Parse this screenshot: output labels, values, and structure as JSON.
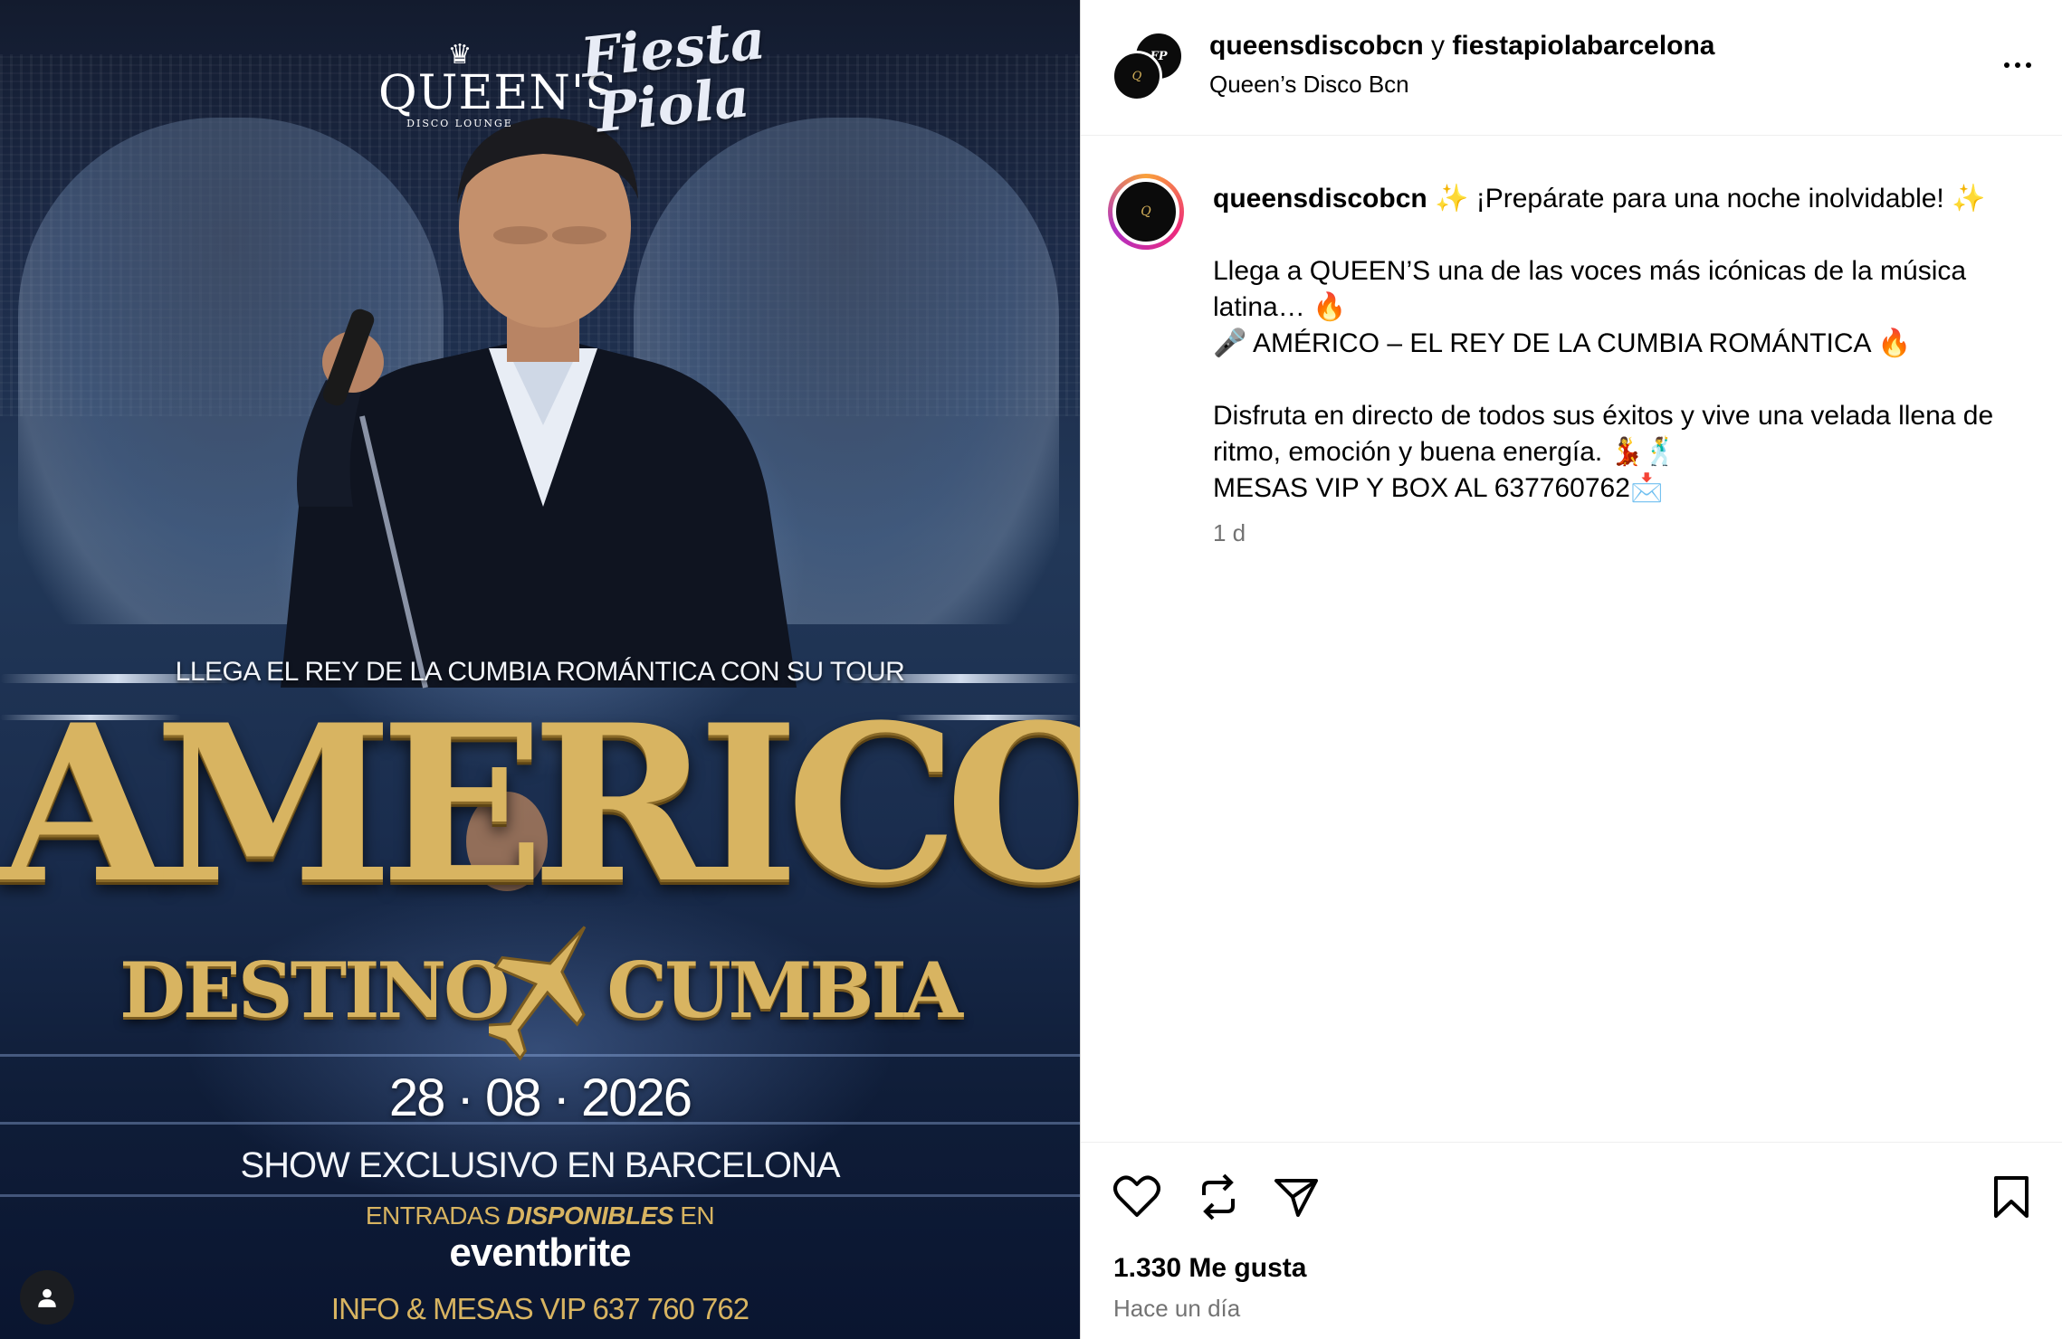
{
  "poster": {
    "logo_queens_big": "QUEEN'S",
    "logo_queens_small": "DISCO LOUNGE",
    "logo_fiesta": "Fiesta Piola",
    "tour_line": "LLEGA EL REY DE LA CUMBIA ROMÁNTICA CON SU TOUR",
    "artist": "AMERICO",
    "tour_left": "DESTINO",
    "tour_right": "CUMBIA",
    "date": "28 · 08 · 2026",
    "show": "SHOW EXCLUSIVO EN BARCELONA",
    "entradas_pre": "ENTRADAS ",
    "entradas_em": "DISPONIBLES",
    "entradas_post": " EN",
    "ticket_platform": "eventbrite",
    "info": "INFO & MESAS VIP 637 760 762"
  },
  "header": {
    "user1": "queensdiscobcn",
    "connector": " y ",
    "user2": "fiestapiolabarcelona",
    "location": "Queen’s Disco Bcn"
  },
  "caption": {
    "username": "queensdiscobcn",
    "line1": " ✨ ¡Prepárate para una noche inolvidable! ✨",
    "line2": "Llega a QUEEN’S una de las voces más icónicas de la música latina… 🔥",
    "line3": "🎤 AMÉRICO – EL REY DE LA CUMBIA ROMÁNTICA 🔥",
    "line4": "Disfruta en directo de todos sus éxitos y vive una velada llena de ritmo, emoción y buena energía. 💃🕺",
    "line5": "MESAS VIP Y BOX AL 637760762📩",
    "time": "1 d"
  },
  "footer": {
    "likes": "1.330 Me gusta",
    "time": "Hace un día"
  },
  "icons": {
    "like": "heart-icon",
    "repost": "repost-icon",
    "share": "share-icon",
    "save": "bookmark-icon",
    "more": "more-icon",
    "tag": "user-tag-icon"
  },
  "colors": {
    "gold": "#d8b461",
    "muted": "#737373",
    "story_ring": "#ee2a7b"
  }
}
